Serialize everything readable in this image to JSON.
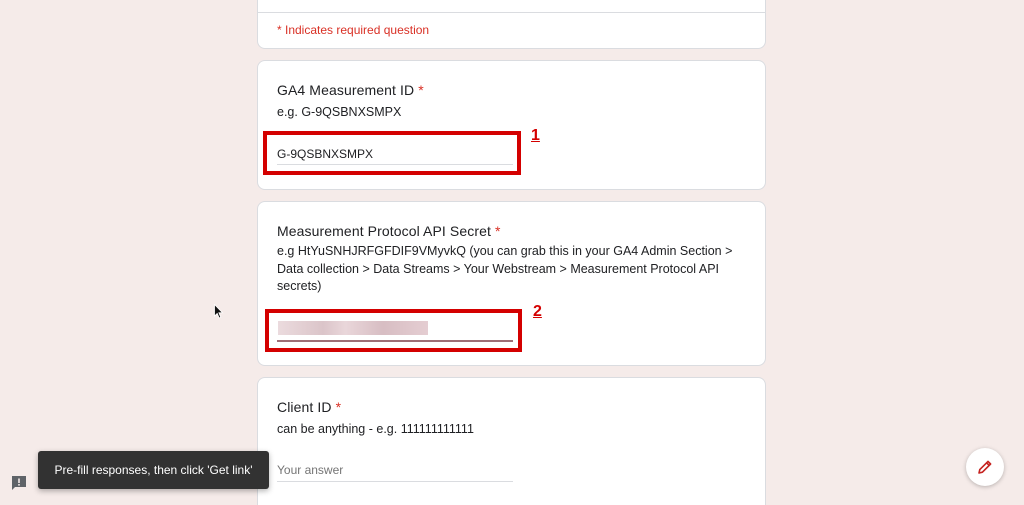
{
  "form": {
    "required_note": "* Indicates required question",
    "questions": [
      {
        "title": "GA4 Measurement ID",
        "required_mark": "*",
        "description": "e.g. G-9QSBNXSMPX",
        "answer_value": "G-9QSBNXSMPX"
      },
      {
        "title": "Measurement Protocol API Secret",
        "required_mark": "*",
        "description": "e.g HtYuSNHJRFGFDIF9VMyvkQ (you can grab this in your GA4 Admin Section > Data collection > Data Streams > Your Webstream > Measurement Protocol API secrets)",
        "answer_value": ""
      },
      {
        "title": "Client ID",
        "required_mark": "*",
        "description": "can be anything - e.g. 111111111111",
        "answer_placeholder": "Your answer"
      }
    ]
  },
  "annotations": {
    "step1": "1",
    "step2": "2",
    "box_color": "#d40000"
  },
  "toast": {
    "message": "Pre-fill responses, then click 'Get link'"
  },
  "icons": {
    "feedback": "feedback-icon",
    "edit": "pencil-icon",
    "cursor": "mouse-pointer-icon"
  },
  "colors": {
    "page_background": "#f5ebe9",
    "required": "#d93025",
    "fab_icon": "#c5221f"
  }
}
